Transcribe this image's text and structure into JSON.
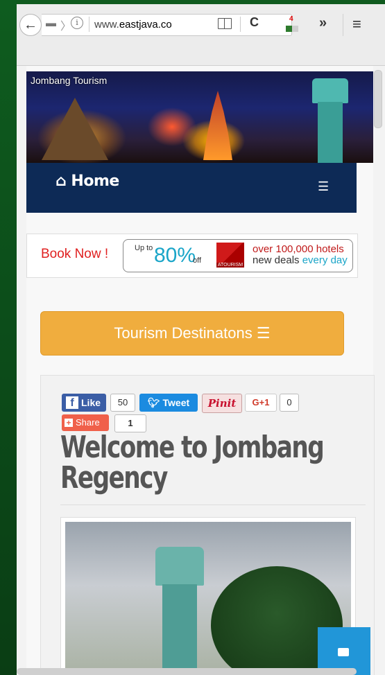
{
  "browser": {
    "url_prefix": "www.",
    "url_domain": "eastjava.co",
    "extension_badge": "4",
    "overflow_glyph": "»",
    "menu_glyph": "≡",
    "back_glyph": "←",
    "reload_glyph": "C",
    "info_glyph": "i"
  },
  "banner": {
    "title": "Jombang Tourism"
  },
  "navbar": {
    "home_label": "Home",
    "home_icon": "⌂",
    "toggle_icon": "☰"
  },
  "ad": {
    "book_now": "Book Now !",
    "upto": "Up to",
    "percent": "80%",
    "off": "off",
    "brand": "ATOURISM",
    "hotels_line1": "over 100,000 hotels",
    "hotels_line2_a": "new deals",
    "hotels_line2_b": "every day"
  },
  "destinations_button": "Tourism Destinatons ☰",
  "social": {
    "like_label": "Like",
    "like_count": "50",
    "tweet_label": "Tweet",
    "pinit_label": "Pinit",
    "gplus_label": "G+1",
    "gplus_count": "0",
    "share_label": "Share",
    "share_count": "1"
  },
  "article": {
    "headline": "Welcome to Jombang Regency"
  },
  "colors": {
    "navbar": "#0d2a56",
    "dest_button": "#f0ad3e",
    "facebook": "#3b5ea6",
    "twitter": "#1b8be0",
    "chat": "#2196d8"
  }
}
